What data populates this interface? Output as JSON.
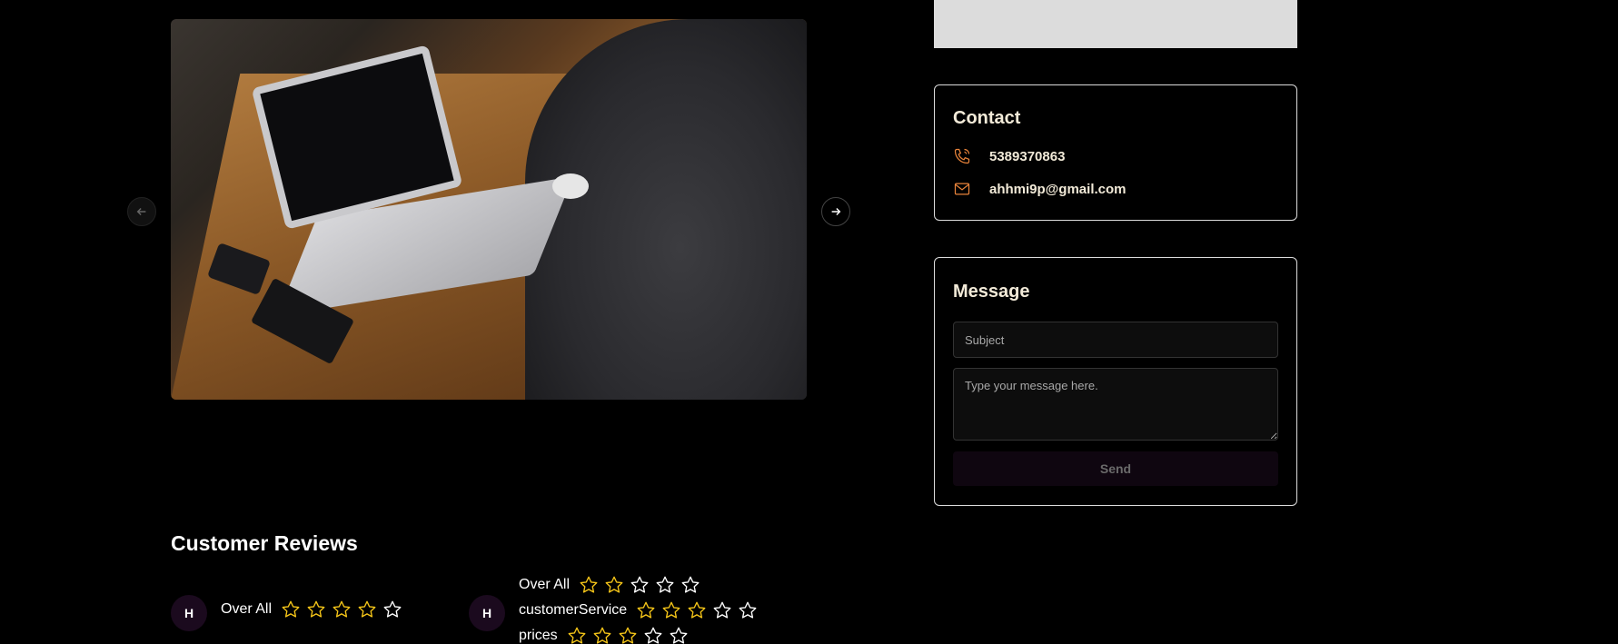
{
  "contact": {
    "title": "Contact",
    "phone": "5389370863",
    "email": "ahhmi9p@gmail.com",
    "accent_color": "#e8833a"
  },
  "message": {
    "title": "Message",
    "subject_placeholder": "Subject",
    "body_placeholder": "Type your message here.",
    "send_label": "Send"
  },
  "reviews": {
    "title": "Customer Reviews",
    "star_color": "#f5c518",
    "items": [
      {
        "avatar": "H",
        "ratings": [
          {
            "label": "Over All",
            "value": 4,
            "max": 5
          }
        ]
      },
      {
        "avatar": "H",
        "ratings": [
          {
            "label": "Over All",
            "value": 2,
            "max": 5
          },
          {
            "label": "customerService",
            "value": 3,
            "max": 5
          },
          {
            "label": "prices",
            "value": 3,
            "max": 5
          }
        ]
      }
    ]
  }
}
